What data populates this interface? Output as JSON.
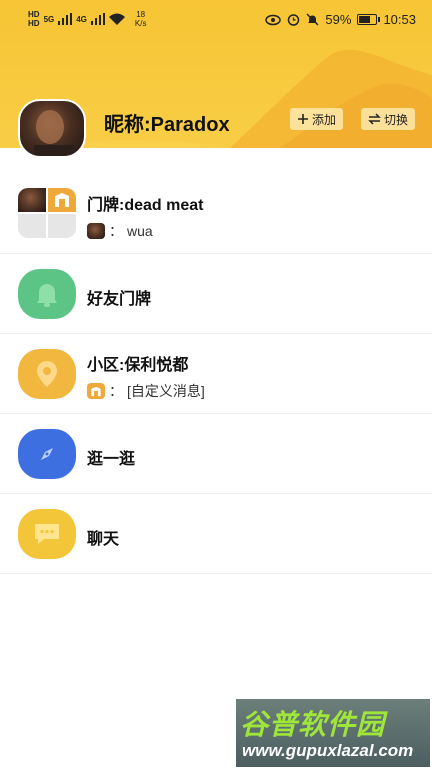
{
  "status_bar": {
    "left_labels": [
      "HD",
      "5G",
      "4G"
    ],
    "speed_value": "18",
    "speed_unit": "K/s",
    "battery_percent": "59%",
    "battery_level": 0.59,
    "time": "10:53"
  },
  "header": {
    "nickname": "昵称:Paradox",
    "add_label": "添加",
    "switch_label": "切换",
    "bg_color": "#f7c535"
  },
  "list": [
    {
      "id": "doorplate",
      "title": "门牌:dead meat",
      "sub_text": "wua",
      "sub_icon": "avatar-photo"
    },
    {
      "id": "friend-doorplate",
      "title": "好友门牌",
      "icon": "bell-icon",
      "icon_color": "#5cc585"
    },
    {
      "id": "community",
      "title": "小区:保利悦都",
      "sub_text": "[自定义消息]",
      "sub_icon": "doorplate-logo",
      "icon": "location-pin-icon",
      "icon_color": "#f1b73e"
    },
    {
      "id": "explore",
      "title": "逛一逛",
      "icon": "compass-icon",
      "icon_color": "#3d6fe0"
    },
    {
      "id": "chat",
      "title": "聊天",
      "icon": "chat-bubble-icon",
      "icon_color": "#f3c63a"
    }
  ],
  "watermark": {
    "title": "谷普软件园",
    "url": "www.gupuxlazal.com"
  }
}
